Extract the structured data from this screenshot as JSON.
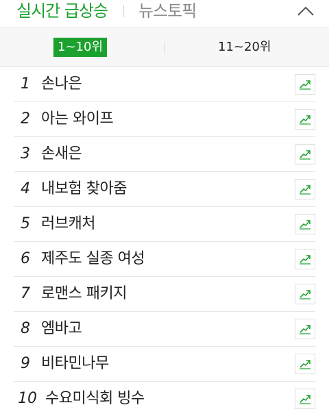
{
  "header": {
    "active_tab": "실시간 급상승",
    "tab": "뉴스토픽"
  },
  "subtabs": {
    "active": "1~10위",
    "other": "11~20위"
  },
  "colors": {
    "accent": "#1ca12e"
  },
  "icons": {
    "collapse": "chevron-up-icon",
    "trend": "trend-chart-icon"
  },
  "rankings": [
    {
      "rank": "1",
      "term": "손나은"
    },
    {
      "rank": "2",
      "term": "아는 와이프"
    },
    {
      "rank": "3",
      "term": "손새은"
    },
    {
      "rank": "4",
      "term": "내보험 찾아줌"
    },
    {
      "rank": "5",
      "term": "러브캐처"
    },
    {
      "rank": "6",
      "term": "제주도 실종 여성"
    },
    {
      "rank": "7",
      "term": "로맨스 패키지"
    },
    {
      "rank": "8",
      "term": "엠바고"
    },
    {
      "rank": "9",
      "term": "비타민나무"
    },
    {
      "rank": "10",
      "term": "수요미식회 빙수"
    }
  ]
}
